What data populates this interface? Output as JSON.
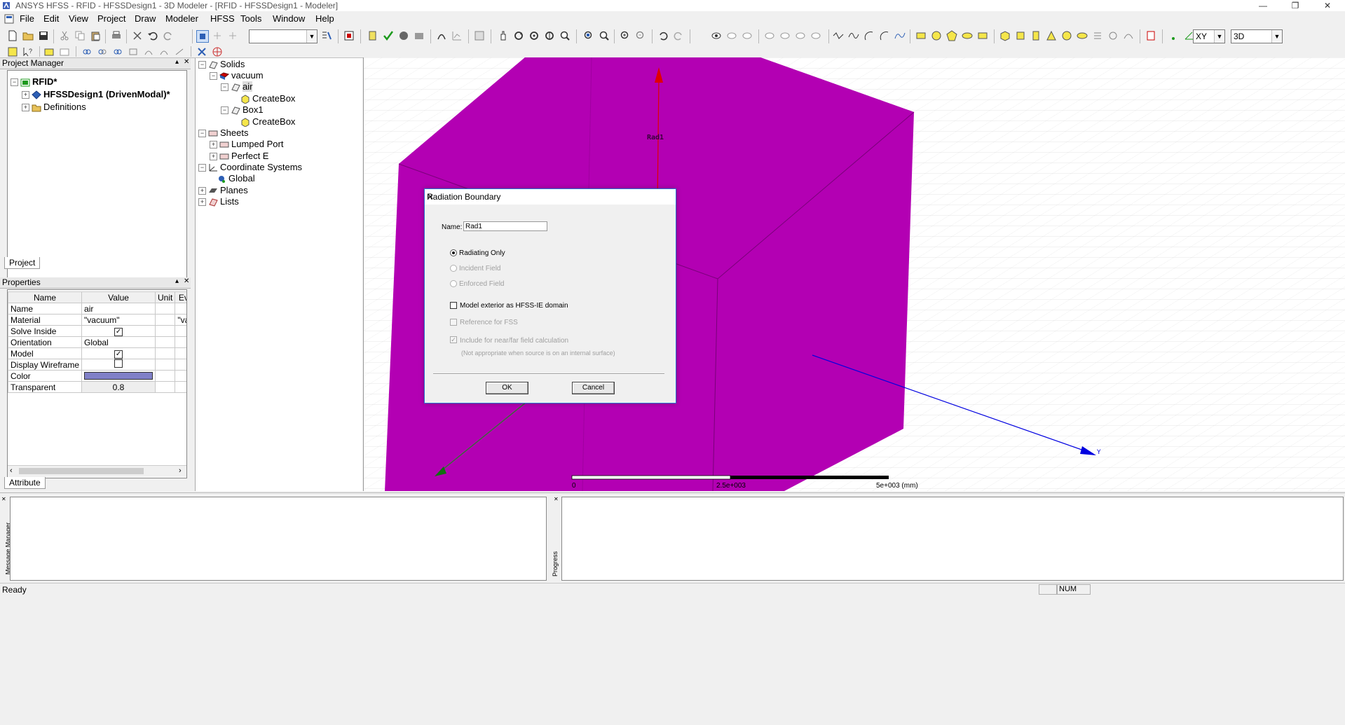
{
  "window": {
    "title": "ANSYS HFSS - RFID - HFSSDesign1 - 3D Modeler - [RFID - HFSSDesign1 - Modeler]",
    "minimize": "—",
    "restore": "❐",
    "close": "✕"
  },
  "menu": [
    "File",
    "Edit",
    "View",
    "Project",
    "Draw",
    "Modeler",
    "HFSS",
    "Tools",
    "Window",
    "Help"
  ],
  "toolbar": {
    "plane_combo": "XY",
    "view_combo": "3D"
  },
  "project_manager": {
    "title": "Project Manager",
    "root": "RFID*",
    "design": "HFSSDesign1 (DrivenModal)*",
    "definitions": "Definitions",
    "tab": "Project"
  },
  "model_tree": {
    "solids": "Solids",
    "vacuum": "vacuum",
    "air": "air",
    "createbox1": "CreateBox",
    "box1": "Box1",
    "createbox2": "CreateBox",
    "sheets": "Sheets",
    "lumped_port": "Lumped Port",
    "perfect_e": "Perfect E",
    "coord_systems": "Coordinate Systems",
    "global": "Global",
    "planes": "Planes",
    "lists": "Lists"
  },
  "properties": {
    "title": "Properties",
    "headers": [
      "Name",
      "Value",
      "Unit",
      "Ev"
    ],
    "rows": [
      {
        "name": "Name",
        "value": "air",
        "ev": ""
      },
      {
        "name": "Material",
        "value": "\"vacuum\"",
        "ev": "\"va"
      },
      {
        "name": "Solve Inside",
        "value": "",
        "ev": ""
      },
      {
        "name": "Orientation",
        "value": "Global",
        "ev": ""
      },
      {
        "name": "Model",
        "value": "",
        "ev": ""
      },
      {
        "name": "Display Wireframe",
        "value": "",
        "ev": ""
      },
      {
        "name": "Color",
        "value": "",
        "ev": ""
      },
      {
        "name": "Transparent",
        "value": "0.8",
        "ev": ""
      }
    ],
    "color_value": "#8080c8",
    "tab": "Attribute"
  },
  "viewport": {
    "box_color": "#b300b3",
    "boundary_label": "Rad1",
    "axis_z_color": "#e00000",
    "axis_y_color": "#0000e0",
    "axis_x_color": "#008000",
    "y_axis_label": "Y",
    "scale": {
      "label0": "0",
      "label_mid": "2.5e+003",
      "label_end": "5e+003 (mm)"
    }
  },
  "dialog": {
    "title": "Radiation Boundary",
    "name_label": "Name:",
    "name_value": "Rad1",
    "radio_radiating": "Radiating Only",
    "radio_incident": "Incident Field",
    "radio_enforced": "Enforced Field",
    "chk_model_exterior": "Model exterior as HFSS-IE domain",
    "chk_reference_fss": "Reference for FSS",
    "chk_nearfar": "Include for near/far field calculation",
    "note": "(Not appropriate when source is on an internal surface)",
    "ok": "OK",
    "cancel": "Cancel"
  },
  "bottom": {
    "message_manager": "Message Manager",
    "progress": "Progress"
  },
  "status": {
    "text": "Ready",
    "num": "NUM"
  }
}
